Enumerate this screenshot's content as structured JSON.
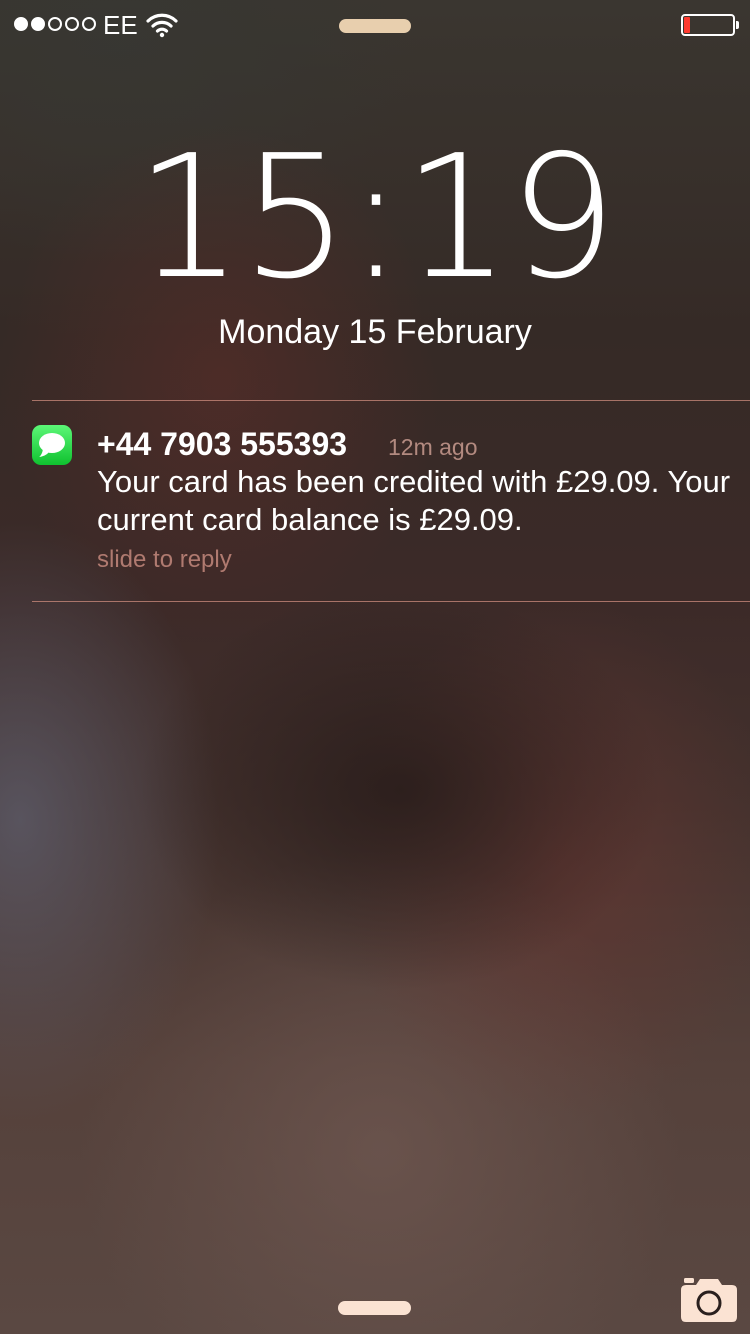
{
  "status_bar": {
    "signal_filled": 2,
    "signal_total": 5,
    "carrier": "EE",
    "battery_level": 0.12,
    "battery_color": "#ff3b30"
  },
  "lock_screen": {
    "time": "15:19",
    "date": "Monday 15 February"
  },
  "notification": {
    "app_icon": "messages-icon",
    "sender": "+44 7903 555393",
    "time_ago": "12m ago",
    "message": "Your card has been credited with £29.09. Your current card balance is £29.09.",
    "action_hint": "slide to reply",
    "accent_color": "#b07a70"
  },
  "bottom": {
    "camera_icon": "camera-icon"
  }
}
